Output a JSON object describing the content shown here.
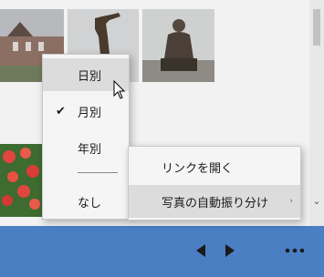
{
  "accent_color": "#4a7fc4",
  "sort_menu": {
    "items": [
      {
        "label": "日別",
        "checked": false,
        "hovered": true
      },
      {
        "label": "月別",
        "checked": true,
        "hovered": false
      },
      {
        "label": "年別",
        "checked": false,
        "hovered": false
      },
      {
        "label": "なし",
        "checked": false,
        "hovered": false
      }
    ],
    "check_glyph": "✔"
  },
  "context_menu": {
    "open_link_label": "リンクを開く",
    "auto_sort_label": "写真の自動振り分け",
    "submenu_glyph": "›"
  },
  "scrollbar": {
    "down_glyph": "⌄"
  },
  "bottom_bar": {
    "prev_icon": "triangle-left",
    "next_icon": "triangle-right",
    "more_icon": "ellipsis"
  }
}
